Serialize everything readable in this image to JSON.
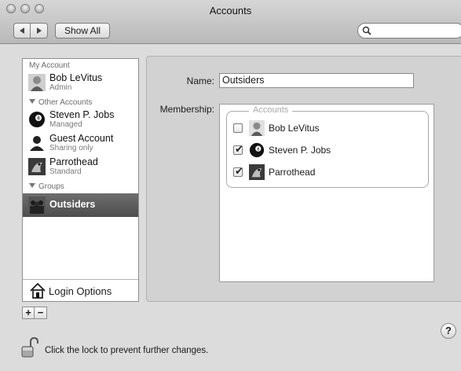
{
  "window": {
    "title": "Accounts"
  },
  "toolbar": {
    "back_icon": "chevron-left-icon",
    "forward_icon": "chevron-right-icon",
    "show_all_label": "Show All",
    "search_value": ""
  },
  "sidebar": {
    "my_account_heading": "My Account",
    "my_account": {
      "name": "Bob LeVitus",
      "role": "Admin"
    },
    "other_heading": "Other Accounts",
    "others": [
      {
        "name": "Steven P. Jobs",
        "role": "Managed"
      },
      {
        "name": "Guest Account",
        "role": "Sharing only"
      },
      {
        "name": "Parrothead",
        "role": "Standard"
      }
    ],
    "groups_heading": "Groups",
    "groups": [
      {
        "name": "Outsiders",
        "selected": true
      }
    ],
    "login_options_label": "Login Options"
  },
  "buttons": {
    "add": "+",
    "remove": "−"
  },
  "detail": {
    "name_label": "Name:",
    "name_value": "Outsiders",
    "membership_label": "Membership:",
    "accounts_legend": "Accounts",
    "members": [
      {
        "name": "Bob LeVitus",
        "checked": false
      },
      {
        "name": "Steven P. Jobs",
        "checked": true
      },
      {
        "name": "Parrothead",
        "checked": true
      }
    ]
  },
  "footer": {
    "lock_text": "Click the lock to prevent further changes.",
    "help_label": "?"
  }
}
